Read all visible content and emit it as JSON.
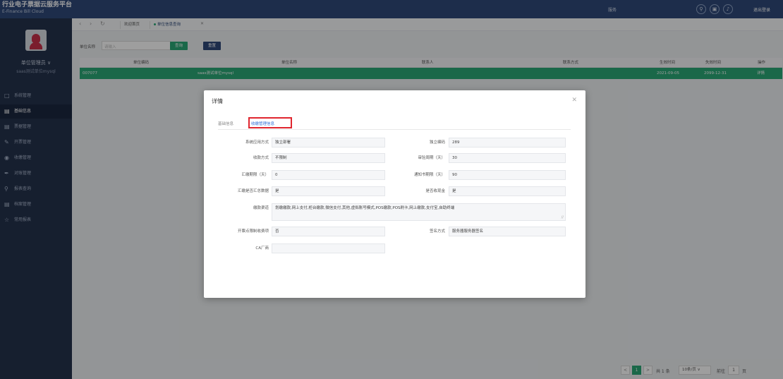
{
  "app": {
    "title": "行业电子票据云服务平台",
    "subtitle": "E-Finance Bill Cloud"
  },
  "header": {
    "search_label": "服务",
    "logout": "退出登录"
  },
  "user": {
    "role": "单位管理员 ∨",
    "unit": "saas测试单位mysql"
  },
  "sidebar": {
    "items": [
      {
        "label": "系统管理",
        "icon": "monitor-icon"
      },
      {
        "label": "基础信息",
        "icon": "info-icon",
        "active": true
      },
      {
        "label": "票据管理",
        "icon": "bill-icon"
      },
      {
        "label": "开票管理",
        "icon": "edit-icon"
      },
      {
        "label": "收缴管理",
        "icon": "collect-icon"
      },
      {
        "label": "对账管理",
        "icon": "pen-icon"
      },
      {
        "label": "报表查询",
        "icon": "search-icon"
      },
      {
        "label": "档案管理",
        "icon": "archive-icon"
      },
      {
        "label": "常用报表",
        "icon": "star-icon"
      }
    ]
  },
  "tabs": {
    "home": "欢迎首页",
    "active": "单位信息查询"
  },
  "filter": {
    "label": "单位名称",
    "placeholder": "请输入",
    "query_button": "查询",
    "reset_button": "重置"
  },
  "table": {
    "headers": [
      "单位编码",
      "单位名称",
      "联系人",
      "联系方式",
      "生效时间",
      "失效时间",
      "操作"
    ],
    "rows": [
      {
        "code": "007077",
        "name": "saas测试单位mysql",
        "contact": "",
        "phone": "",
        "start": "2021-09-05",
        "end": "2099-12-31",
        "action": "详情"
      }
    ]
  },
  "pagination": {
    "prev": "<",
    "current": "1",
    "next": ">",
    "total": "共 1 条",
    "page_size": "10条/页 ∨",
    "goto_label": "前往",
    "goto_value": "1",
    "page_unit": "页"
  },
  "modal": {
    "title": "详情",
    "tabs": [
      "基础信息",
      "收缴管理信息"
    ],
    "fields": {
      "sys_mode_label": "系统应用方式",
      "sys_mode_value": "独立部署",
      "indep_code_label": "独立编码",
      "indep_code_value": "289",
      "collect_mode_label": "收款方式",
      "collect_mode_value": "不限制",
      "audit_cycle_label": "审验周期（天）",
      "audit_cycle_value": "30",
      "remit_limit_label": "汇缴期限（天）",
      "remit_limit_value": "0",
      "notice_limit_label": "通知书期限（天）",
      "notice_limit_value": "90",
      "remit_summary_label": "汇缴是否汇总数据",
      "remit_summary_value": "是",
      "cash_label": "是否收现金",
      "cash_value": "是",
      "channel_label": "缴款渠道",
      "channel_value": "划缴缴款,网上支付,柜台缴款,微信支付,其他,虚拟账号模式,POS缴款,POS刷卡,网上缴款,支付宝,自助终端",
      "bill_audit_label": "开票点限制收费项",
      "bill_audit_value": "否",
      "sign_mode_label": "签名方式",
      "sign_mode_value": "服务器服务器签名",
      "ca_label": "CA厂商",
      "ca_value": ""
    }
  }
}
